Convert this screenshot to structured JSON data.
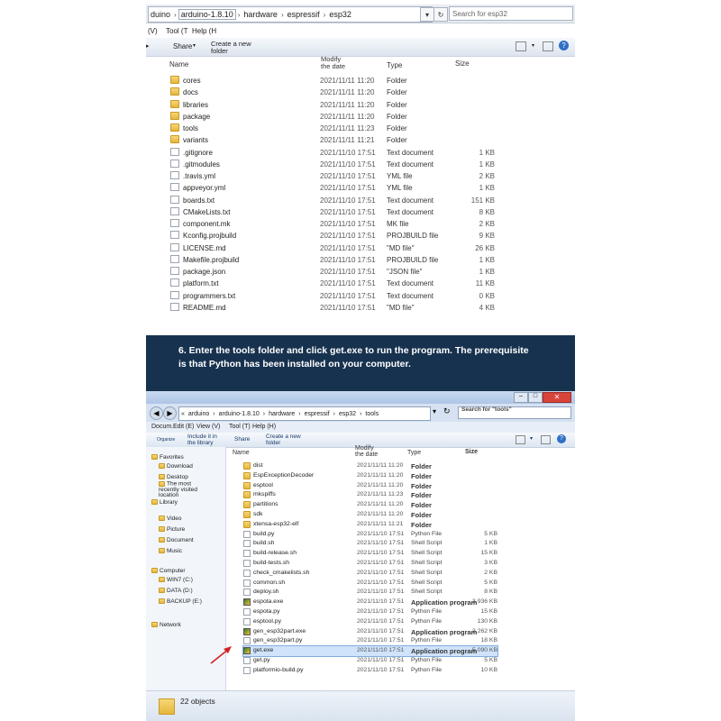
{
  "top": {
    "breadcrumb": [
      "arduino-1.8.10",
      "hardware",
      "espressif",
      "esp32"
    ],
    "breadcrumb_prefix": "duino",
    "search_placeholder": "Search for esp32",
    "menu": [
      "(V)",
      "Tool (T",
      "Help (H"
    ],
    "toolbar": {
      "share": "Share",
      "new_folder": "Create a new folder"
    },
    "columns": {
      "name": "Name",
      "modified": "Modify the date",
      "type": "Type",
      "size": "Size"
    },
    "files": [
      {
        "name": "cores",
        "date": "2021/11/11 11:20",
        "type": "Folder",
        "size": "",
        "kind": "folder"
      },
      {
        "name": "docs",
        "date": "2021/11/11 11:20",
        "type": "Folder",
        "size": "",
        "kind": "folder"
      },
      {
        "name": "libraries",
        "date": "2021/11/11 11:20",
        "type": "Folder",
        "size": "",
        "kind": "folder"
      },
      {
        "name": "package",
        "date": "2021/11/11 11:20",
        "type": "Folder",
        "size": "",
        "kind": "folder"
      },
      {
        "name": "tools",
        "date": "2021/11/11 11:23",
        "type": "Folder",
        "size": "",
        "kind": "folder"
      },
      {
        "name": "variants",
        "date": "2021/11/11 11:21",
        "type": "Folder",
        "size": "",
        "kind": "folder"
      },
      {
        "name": ".gitignore",
        "date": "2021/11/10 17:51",
        "type": "Text document",
        "size": "1 KB",
        "kind": "file"
      },
      {
        "name": ".gitmodules",
        "date": "2021/11/10 17:51",
        "type": "Text document",
        "size": "1 KB",
        "kind": "file"
      },
      {
        "name": ".travis.yml",
        "date": "2021/11/10 17:51",
        "type": "YML file",
        "size": "2 KB",
        "kind": "file"
      },
      {
        "name": "appveyor.yml",
        "date": "2021/11/10 17:51",
        "type": "YML file",
        "size": "1 KB",
        "kind": "file"
      },
      {
        "name": "boards.txt",
        "date": "2021/11/10 17:51",
        "type": "Text document",
        "size": "151 KB",
        "kind": "file"
      },
      {
        "name": "CMakeLists.txt",
        "date": "2021/11/10 17:51",
        "type": "Text document",
        "size": "8 KB",
        "kind": "file"
      },
      {
        "name": "component.mk",
        "date": "2021/11/10 17:51",
        "type": "MK file",
        "size": "2 KB",
        "kind": "file"
      },
      {
        "name": "Kconfig.projbuild",
        "date": "2021/11/10 17:51",
        "type": "PROJBUILD file",
        "size": "9 KB",
        "kind": "file"
      },
      {
        "name": "LICENSE.md",
        "date": "2021/11/10 17:51",
        "type": "\"MD file\"",
        "size": "26 KB",
        "kind": "file"
      },
      {
        "name": "Makefile.projbuild",
        "date": "2021/11/10 17:51",
        "type": "PROJBUILD file",
        "size": "1 KB",
        "kind": "file"
      },
      {
        "name": "package.json",
        "date": "2021/11/10 17:51",
        "type": "\"JSON file\"",
        "size": "1 KB",
        "kind": "file"
      },
      {
        "name": "platform.txt",
        "date": "2021/11/10 17:51",
        "type": "Text document",
        "size": "11 KB",
        "kind": "file"
      },
      {
        "name": "programmers.txt",
        "date": "2021/11/10 17:51",
        "type": "Text document",
        "size": "0 KB",
        "kind": "file"
      },
      {
        "name": "README.md",
        "date": "2021/11/10 17:51",
        "type": "\"MD file\"",
        "size": "4 KB",
        "kind": "file"
      }
    ]
  },
  "banner": {
    "line1": "6. Enter the tools folder and click get.exe to run the program. The prerequisite",
    "line2": "is that Python has been installed on your computer."
  },
  "bottom": {
    "breadcrumb": [
      "arduino",
      "arduino-1.8.10",
      "hardware",
      "espressif",
      "esp32",
      "tools"
    ],
    "search_placeholder": "Search for \"tools\"",
    "menu": [
      "Docum...",
      "Edit (E)",
      "View (V)",
      "Tool (T)",
      "Help (H)"
    ],
    "toolbar": {
      "organize": "Organize",
      "include": "Include it in the library",
      "share": "Share",
      "new_folder": "Create a new folder"
    },
    "columns": {
      "name": "Name",
      "modified": "Modify the date",
      "type": "Type",
      "size": "Size"
    },
    "nav": [
      {
        "label": "Favorites",
        "icon": "star-icon"
      },
      {
        "label": "Download",
        "icon": "folder-icon"
      },
      {
        "label": "Desktop",
        "icon": "desktop-icon"
      },
      {
        "label": "The most recently visited location",
        "icon": "recent-icon"
      },
      {
        "label": "Library",
        "icon": "library-icon"
      },
      {
        "label": "Video",
        "icon": "video-icon"
      },
      {
        "label": "Picture",
        "icon": "picture-icon"
      },
      {
        "label": "Document",
        "icon": "document-icon"
      },
      {
        "label": "Music",
        "icon": "music-icon"
      },
      {
        "label": "Computer",
        "icon": "computer-icon"
      },
      {
        "label": "WIN7 (C:)",
        "icon": "drive-icon"
      },
      {
        "label": "DATA (D:)",
        "icon": "drive-icon"
      },
      {
        "label": "BACKUP (E:)",
        "icon": "drive-icon"
      },
      {
        "label": "Network",
        "icon": "network-icon"
      }
    ],
    "files": [
      {
        "name": "dist",
        "date": "2021/11/11 11:20",
        "type": "Folder",
        "size": "",
        "kind": "folder"
      },
      {
        "name": "EspExceptionDecoder",
        "date": "2021/11/11 11:20",
        "type": "Folder",
        "size": "",
        "kind": "folder"
      },
      {
        "name": "esptool",
        "date": "2021/11/11 11:20",
        "type": "Folder",
        "size": "",
        "kind": "folder"
      },
      {
        "name": "mkspiffs",
        "date": "2021/11/11 11:23",
        "type": "Folder",
        "size": "",
        "kind": "folder"
      },
      {
        "name": "partitions",
        "date": "2021/11/11 11:20",
        "type": "Folder",
        "size": "",
        "kind": "folder"
      },
      {
        "name": "sdk",
        "date": "2021/11/11 11:20",
        "type": "Folder",
        "size": "",
        "kind": "folder"
      },
      {
        "name": "xtensa-esp32-elf",
        "date": "2021/11/11 11:21",
        "type": "Folder",
        "size": "",
        "kind": "folder"
      },
      {
        "name": "build.py",
        "date": "2021/11/10 17:51",
        "type": "Python File",
        "size": "5 KB",
        "kind": "file"
      },
      {
        "name": "build.sh",
        "date": "2021/11/10 17:51",
        "type": "Shell Script",
        "size": "1 KB",
        "kind": "file"
      },
      {
        "name": "build-release.sh",
        "date": "2021/11/10 17:51",
        "type": "Shell Script",
        "size": "15 KB",
        "kind": "file"
      },
      {
        "name": "build-tests.sh",
        "date": "2021/11/10 17:51",
        "type": "Shell Script",
        "size": "3 KB",
        "kind": "file"
      },
      {
        "name": "check_cmakelists.sh",
        "date": "2021/11/10 17:51",
        "type": "Shell Script",
        "size": "2 KB",
        "kind": "file"
      },
      {
        "name": "common.sh",
        "date": "2021/11/10 17:51",
        "type": "Shell Script",
        "size": "5 KB",
        "kind": "file"
      },
      {
        "name": "deploy.sh",
        "date": "2021/11/10 17:51",
        "type": "Shell Script",
        "size": "8 KB",
        "kind": "file"
      },
      {
        "name": "espota.exe",
        "date": "2021/11/10 17:51",
        "type": "Application program",
        "size": "3,936 KB",
        "kind": "exe"
      },
      {
        "name": "espota.py",
        "date": "2021/11/10 17:51",
        "type": "Python File",
        "size": "15 KB",
        "kind": "file"
      },
      {
        "name": "esptool.py",
        "date": "2021/11/10 17:51",
        "type": "Python File",
        "size": "130 KB",
        "kind": "file"
      },
      {
        "name": "gen_esp32part.exe",
        "date": "2021/11/10 17:51",
        "type": "Application program",
        "size": "3,262 KB",
        "kind": "exe"
      },
      {
        "name": "gen_esp32part.py",
        "date": "2021/11/10 17:51",
        "type": "Python File",
        "size": "18 KB",
        "kind": "file"
      },
      {
        "name": "get.exe",
        "date": "2021/11/10 17:51",
        "type": "Application program",
        "size": "5,090 KB",
        "kind": "exe",
        "selected": true
      },
      {
        "name": "get.py",
        "date": "2021/11/10 17:51",
        "type": "Python File",
        "size": "5 KB",
        "kind": "file"
      },
      {
        "name": "platformio-build.py",
        "date": "2021/11/10 17:51",
        "type": "Python File",
        "size": "10 KB",
        "kind": "file"
      }
    ],
    "status": "22 objects"
  },
  "colors": {
    "banner_bg": "#17324f",
    "arrow": "#d32020",
    "selection": "#cfe3fb"
  }
}
